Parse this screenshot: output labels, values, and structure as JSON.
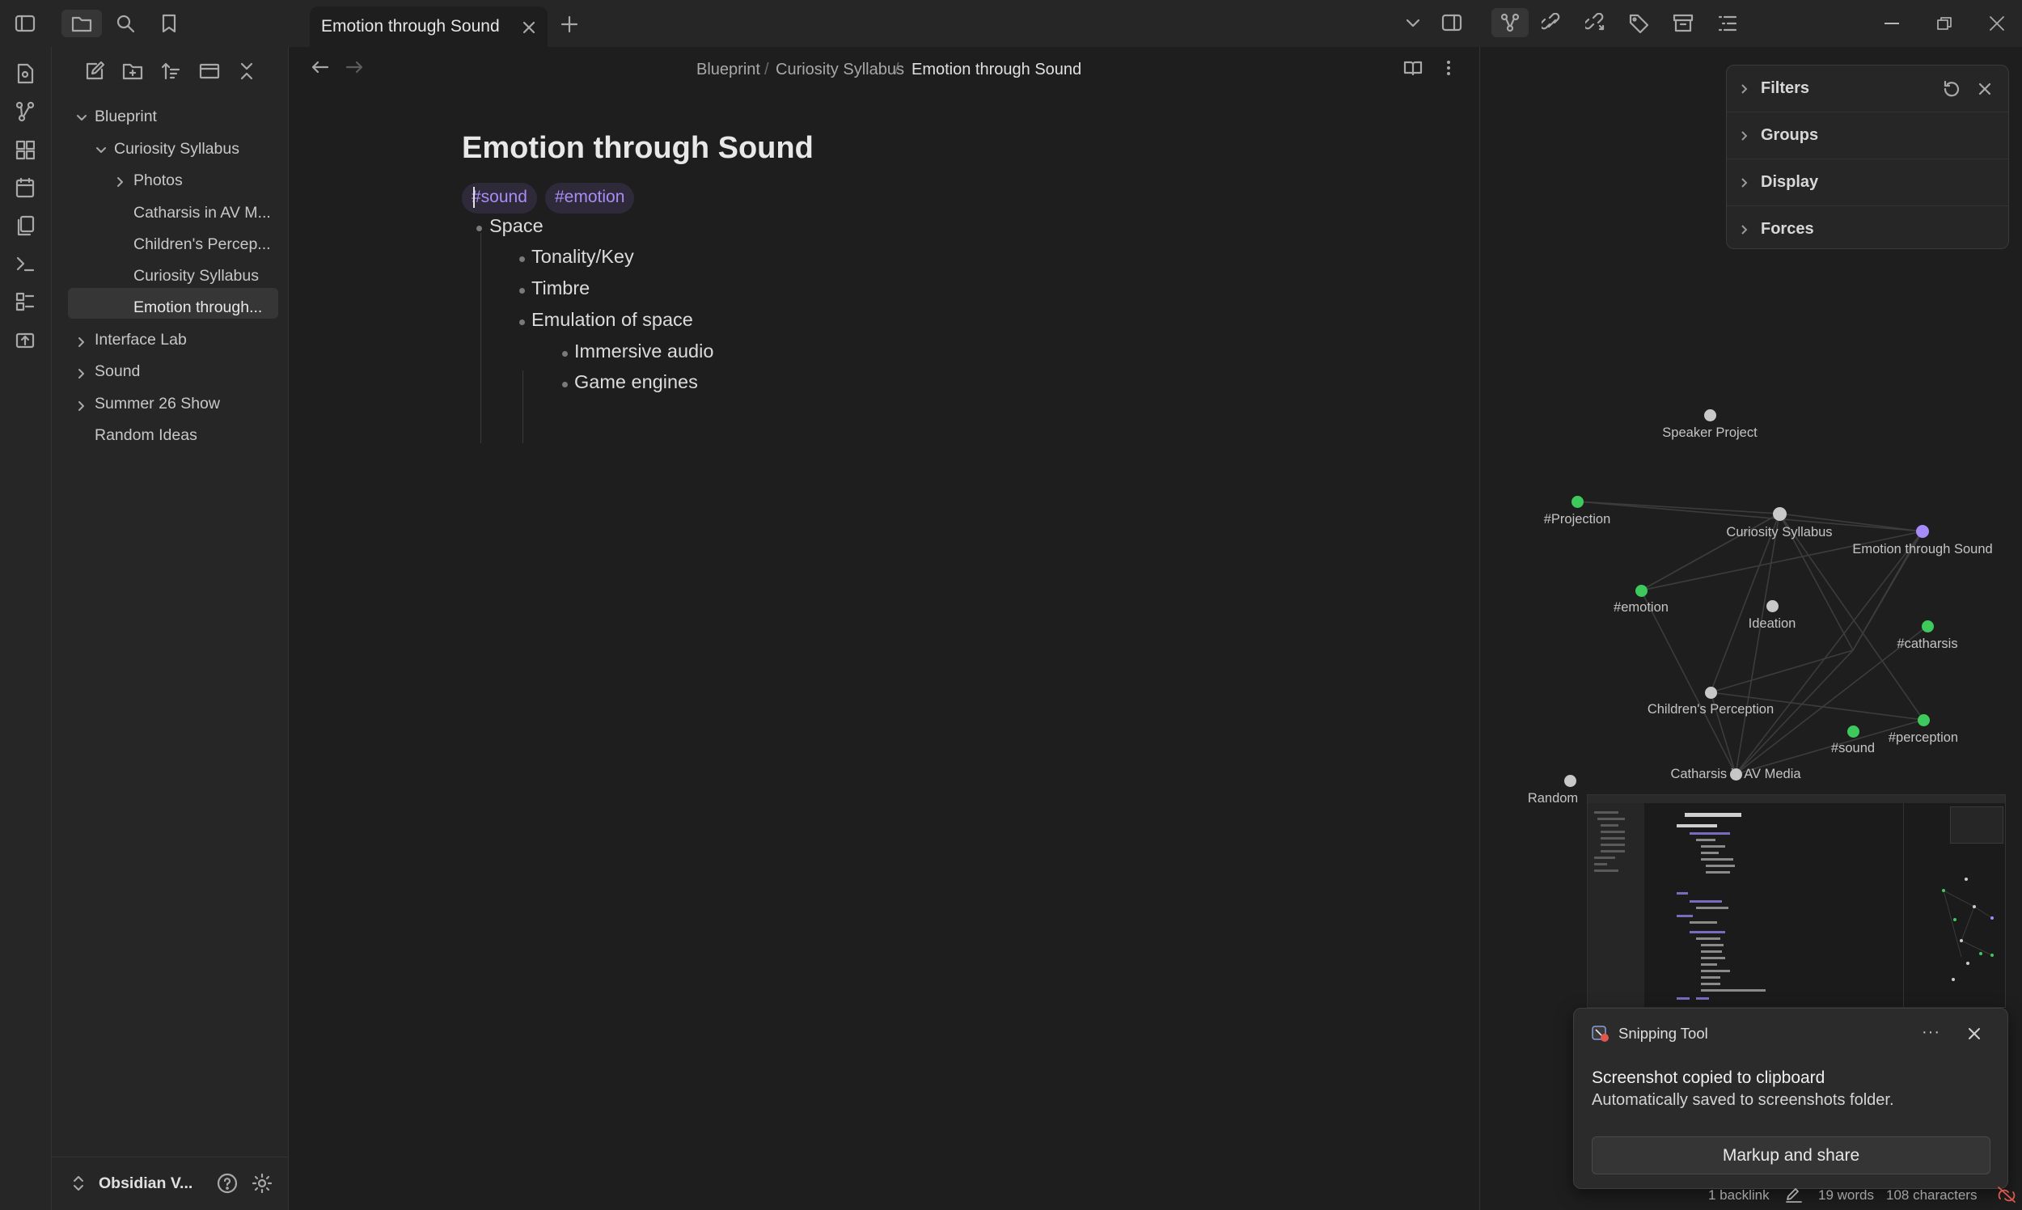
{
  "tabs": [
    {
      "label": "Emotion through Sound"
    }
  ],
  "breadcrumb": {
    "items": [
      "Blueprint",
      "Curiosity Syllabus",
      "Emotion through Sound"
    ],
    "separator": "/"
  },
  "sidebar": {
    "vault_name": "Obsidian V...",
    "tree": [
      {
        "label": "Blueprint",
        "type": "folder",
        "expanded": true
      },
      {
        "label": "Curiosity Syllabus",
        "type": "folder",
        "expanded": true
      },
      {
        "label": "Photos",
        "type": "folder",
        "expanded": false
      },
      {
        "label": "Catharsis in AV M...",
        "type": "file"
      },
      {
        "label": "Children's Percep...",
        "type": "file"
      },
      {
        "label": "Curiosity Syllabus",
        "type": "file"
      },
      {
        "label": "Emotion through...",
        "type": "file",
        "selected": true
      },
      {
        "label": "Interface Lab",
        "type": "folder",
        "expanded": false
      },
      {
        "label": "Sound",
        "type": "folder",
        "expanded": false
      },
      {
        "label": "Summer 26 Show",
        "type": "folder",
        "expanded": false
      },
      {
        "label": "Random Ideas",
        "type": "file"
      }
    ]
  },
  "note": {
    "title": "Emotion through Sound",
    "tags": [
      "#sound",
      "#emotion"
    ],
    "outline": [
      {
        "text": "Space",
        "level": 0
      },
      {
        "text": "Tonality/Key",
        "level": 1
      },
      {
        "text": "Timbre",
        "level": 1
      },
      {
        "text": "Emulation of space",
        "level": 1
      },
      {
        "text": "Immersive audio",
        "level": 2
      },
      {
        "text": "Game engines",
        "level": 2
      }
    ]
  },
  "graph": {
    "panel": {
      "sections": [
        "Filters",
        "Groups",
        "Display",
        "Forces"
      ]
    },
    "nodes": [
      {
        "label": "Speaker Project",
        "color": "#c8c8c8"
      },
      {
        "label": "#Projection",
        "color": "#3ec95c"
      },
      {
        "label": "Curiosity Syllabus",
        "color": "#c8c8c8"
      },
      {
        "label": "Emotion through Sound",
        "color": "#a78bfa"
      },
      {
        "label": "#emotion",
        "color": "#3ec95c"
      },
      {
        "label": "Ideation",
        "color": "#c8c8c8"
      },
      {
        "label": "#catharsis",
        "color": "#3ec95c"
      },
      {
        "label": "Children's Perception",
        "color": "#c8c8c8"
      },
      {
        "label": "#sound",
        "color": "#3ec95c"
      },
      {
        "label": "#perception",
        "color": "#3ec95c"
      },
      {
        "label": "Catharsis in AV Media",
        "color": "#c8c8c8"
      },
      {
        "label": "Random",
        "color": "#c8c8c8"
      }
    ]
  },
  "toast": {
    "app": "Snipping Tool",
    "title": "Screenshot copied to clipboard",
    "subtitle": "Automatically saved to screenshots folder.",
    "button": "Markup and share"
  },
  "status": {
    "backlinks": "1 backlink",
    "words": "19 words",
    "characters": "108 characters"
  },
  "colors": {
    "accent": "#a78bfa",
    "tag_text": "#a98cf5",
    "tag_node": "#3ec95c"
  }
}
